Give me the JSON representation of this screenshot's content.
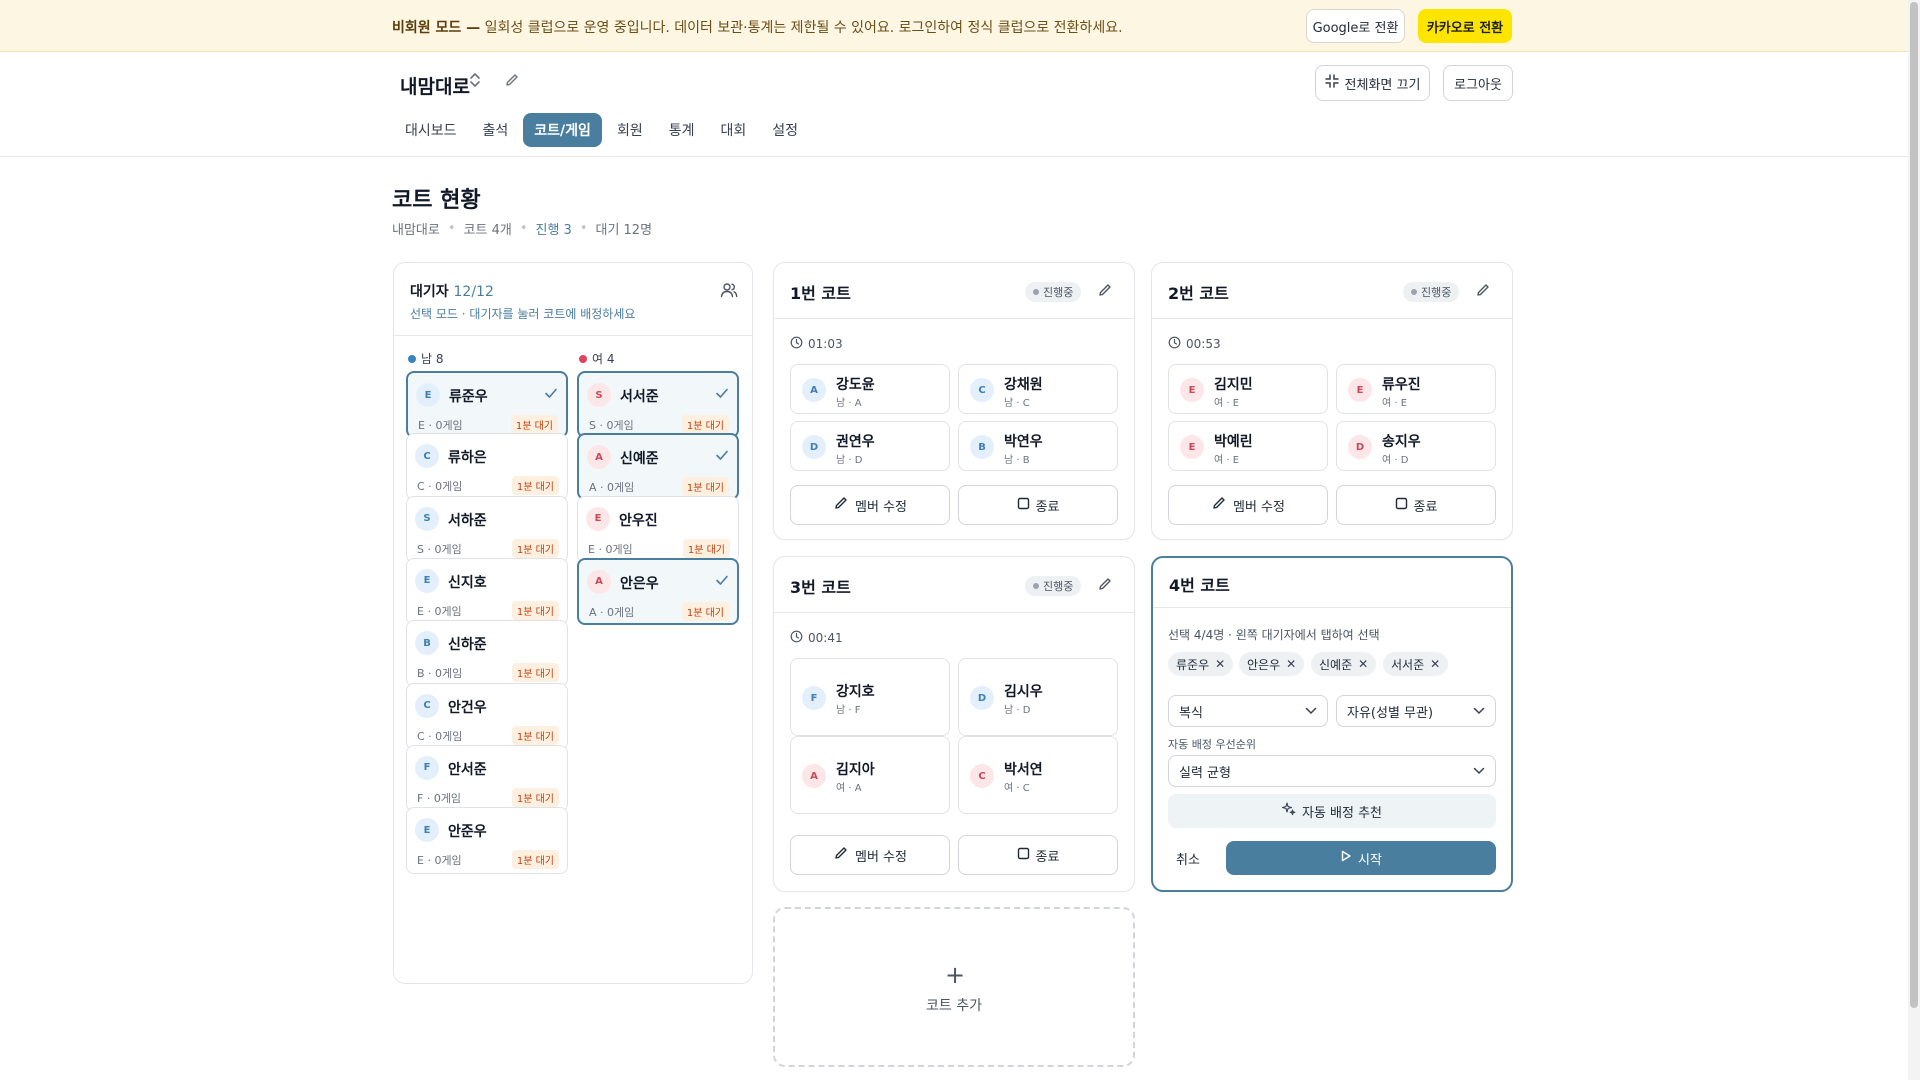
{
  "banner": {
    "mode_label": "비회원 모드 —",
    "message": " 일회성 클럽으로 운영 중입니다. 데이터 보관·통계는 제한될 수 있어요. 로그인하여 정식 클럽으로 전환하세요.",
    "google_button": "Google로 전환",
    "kakao_button": "카카오로 전환"
  },
  "header": {
    "club_name": "내맘대로",
    "fullscreen_button": "전체화면 끄기",
    "logout_button": "로그아웃",
    "tabs": [
      {
        "label": "대시보드"
      },
      {
        "label": "출석"
      },
      {
        "label": "코트/게임"
      },
      {
        "label": "회원"
      },
      {
        "label": "통계"
      },
      {
        "label": "대회"
      },
      {
        "label": "설정"
      }
    ]
  },
  "page": {
    "title": "코트 현황",
    "breadcrumb": {
      "club": "내맘대로",
      "courts": "코트 4개",
      "playing": "진행 3",
      "waiting": "대기 12명"
    }
  },
  "waiting_panel": {
    "title": "대기자",
    "count": "12/12",
    "subtitle": "선택 모드 · 대기자를 눌러 코트에 배정하세요",
    "male_label": "남 8",
    "female_label": "여 4",
    "male": [
      {
        "grade": "E",
        "name": "류준우",
        "meta": "E · 0게임",
        "wait": "1분 대기",
        "selected": true
      },
      {
        "grade": "C",
        "name": "류하은",
        "meta": "C · 0게임",
        "wait": "1분 대기",
        "selected": false
      },
      {
        "grade": "S",
        "name": "서하준",
        "meta": "S · 0게임",
        "wait": "1분 대기",
        "selected": false
      },
      {
        "grade": "E",
        "name": "신지호",
        "meta": "E · 0게임",
        "wait": "1분 대기",
        "selected": false
      },
      {
        "grade": "B",
        "name": "신하준",
        "meta": "B · 0게임",
        "wait": "1분 대기",
        "selected": false
      },
      {
        "grade": "C",
        "name": "안건우",
        "meta": "C · 0게임",
        "wait": "1분 대기",
        "selected": false
      },
      {
        "grade": "F",
        "name": "안서준",
        "meta": "F · 0게임",
        "wait": "1분 대기",
        "selected": false
      },
      {
        "grade": "E",
        "name": "안준우",
        "meta": "E · 0게임",
        "wait": "1분 대기",
        "selected": false
      }
    ],
    "female": [
      {
        "grade": "S",
        "name": "서서준",
        "meta": "S · 0게임",
        "wait": "1분 대기",
        "selected": true
      },
      {
        "grade": "A",
        "name": "신예준",
        "meta": "A · 0게임",
        "wait": "1분 대기",
        "selected": true
      },
      {
        "grade": "E",
        "name": "안우진",
        "meta": "E · 0게임",
        "wait": "1분 대기",
        "selected": false
      },
      {
        "grade": "A",
        "name": "안은우",
        "meta": "A · 0게임",
        "wait": "1분 대기",
        "selected": true
      }
    ]
  },
  "courts": [
    {
      "title": "1번 코트",
      "status": "진행중",
      "timer": "01:03",
      "players": [
        {
          "grade": "A",
          "name": "강도윤",
          "meta": "남 · A",
          "gender": "m"
        },
        {
          "grade": "C",
          "name": "강채원",
          "meta": "남 · C",
          "gender": "m"
        },
        {
          "grade": "D",
          "name": "권연우",
          "meta": "남 · D",
          "gender": "m"
        },
        {
          "grade": "B",
          "name": "박연우",
          "meta": "남 · B",
          "gender": "m"
        }
      ],
      "edit_button": "멤버 수정",
      "end_button": "종료"
    },
    {
      "title": "2번 코트",
      "status": "진행중",
      "timer": "00:53",
      "players": [
        {
          "grade": "E",
          "name": "김지민",
          "meta": "여 · E",
          "gender": "f"
        },
        {
          "grade": "E",
          "name": "류우진",
          "meta": "여 · E",
          "gender": "f"
        },
        {
          "grade": "E",
          "name": "박예린",
          "meta": "여 · E",
          "gender": "f"
        },
        {
          "grade": "D",
          "name": "송지우",
          "meta": "여 · D",
          "gender": "f"
        }
      ],
      "edit_button": "멤버 수정",
      "end_button": "종료"
    },
    {
      "title": "3번 코트",
      "status": "진행중",
      "timer": "00:41",
      "players": [
        {
          "grade": "F",
          "name": "강지호",
          "meta": "남 · F",
          "gender": "m"
        },
        {
          "grade": "D",
          "name": "김시우",
          "meta": "남 · D",
          "gender": "m"
        },
        {
          "grade": "A",
          "name": "김지아",
          "meta": "여 · A",
          "gender": "f"
        },
        {
          "grade": "C",
          "name": "박서연",
          "meta": "여 · C",
          "gender": "f"
        }
      ],
      "edit_button": "멤버 수정",
      "end_button": "종료"
    }
  ],
  "court4": {
    "title": "4번 코트",
    "selection_info": "선택 4/4명 · 왼쪽 대기자에서 탭하여 선택",
    "chips": [
      "류준우",
      "안은우",
      "신예준",
      "서서준"
    ],
    "game_type": "복식",
    "gender_mode": "자유(성별 무관)",
    "priority_label": "자동 배정 우선순위",
    "priority": "실력 균형",
    "auto_button": "자동 배정 추천",
    "cancel_button": "취소",
    "start_button": "시작"
  },
  "add_court": {
    "label": "코트 추가"
  },
  "colors": {
    "accent": "#4a7e9e",
    "male_dot": "#3b82c4",
    "female_dot": "#e0435a",
    "kakao": "#fde500"
  }
}
